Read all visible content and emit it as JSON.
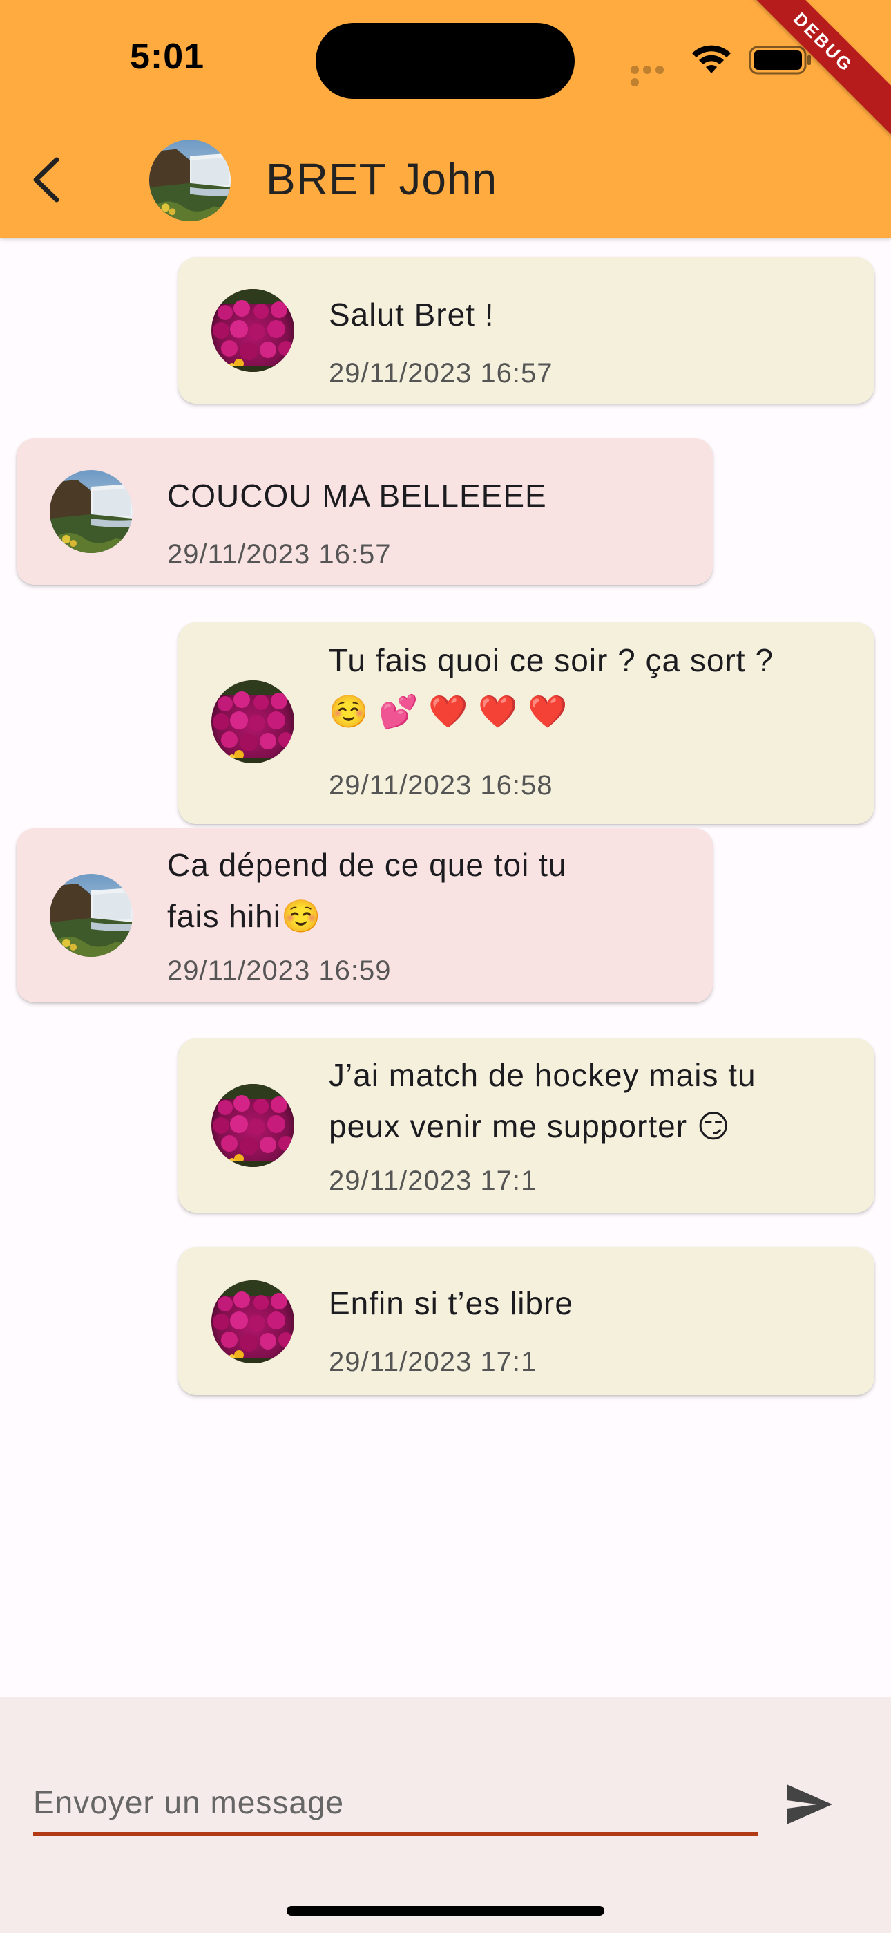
{
  "status_bar": {
    "time": "5:01",
    "debug_label": "DEBUG"
  },
  "header": {
    "title": "BRET John",
    "avatar_image": "waterfall-landscape"
  },
  "messages": [
    {
      "direction": "sent",
      "avatar_image": "purple-flowers",
      "text": "Salut Bret !",
      "timestamp": "29/11/2023 16:57"
    },
    {
      "direction": "received",
      "avatar_image": "waterfall-landscape",
      "text": "COUCOU MA BELLEEEE",
      "timestamp": "29/11/2023 16:57"
    },
    {
      "direction": "sent",
      "avatar_image": "purple-flowers",
      "text": "Tu fais quoi ce soir ? ça sort ?",
      "text_line2": "☺️ 💕 ❤️ ❤️ ❤️",
      "timestamp": "29/11/2023 16:58"
    },
    {
      "direction": "received",
      "avatar_image": "waterfall-landscape",
      "text": "Ca dépend de ce que toi tu",
      "text_line2": "fais hihi☺️",
      "timestamp": "29/11/2023 16:59"
    },
    {
      "direction": "sent",
      "avatar_image": "purple-flowers",
      "text": "J’ai match de hockey mais tu",
      "text_line2": "peux venir me supporter 😏",
      "timestamp": "29/11/2023 17:1"
    },
    {
      "direction": "sent",
      "avatar_image": "purple-flowers",
      "text": "Enfin si t’es libre",
      "timestamp": "29/11/2023 17:1"
    }
  ],
  "composer": {
    "placeholder": "Envoyer un message",
    "value": "",
    "send_icon": "send-icon"
  },
  "colors": {
    "app_bar": "#ffab40",
    "sent_bubble": "#f4f0dc",
    "received_bubble": "#f9e3e2",
    "input_underline": "#b23a14",
    "composer_background": "#f5ebea"
  }
}
